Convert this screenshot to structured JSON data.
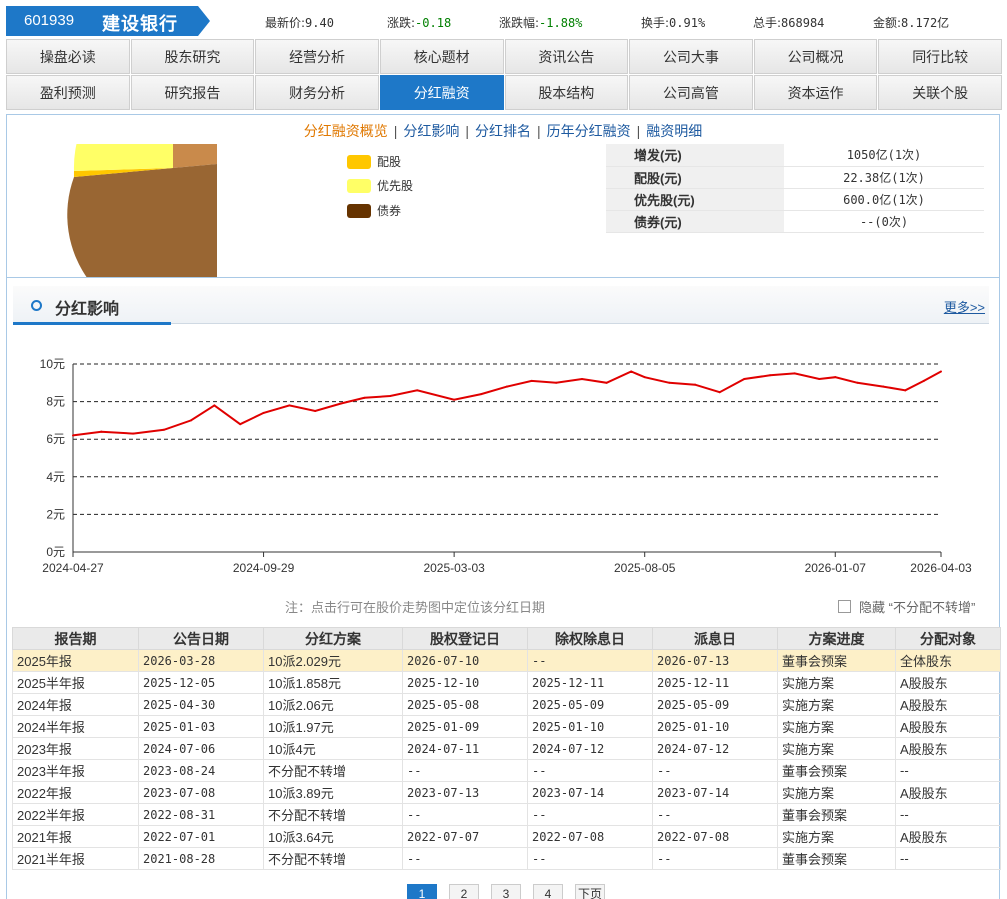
{
  "header": {
    "code": "601939",
    "name": "建设银行",
    "quotes": [
      {
        "label": "最新价:",
        "value": "9.40",
        "green": false
      },
      {
        "label": "涨跌:",
        "value": "-0.18",
        "green": true
      },
      {
        "label": "涨跌幅:",
        "value": "-1.88%",
        "green": true
      },
      {
        "label": "换手:",
        "value": "0.91%",
        "green": false
      },
      {
        "label": "总手:",
        "value": "868984",
        "green": false
      },
      {
        "label": "金额:",
        "value": "8.172亿",
        "green": false
      }
    ]
  },
  "nav": {
    "row1": [
      "操盘必读",
      "股东研究",
      "经营分析",
      "核心题材",
      "资讯公告",
      "公司大事",
      "公司概况",
      "同行比较"
    ],
    "row2": [
      "盈利预测",
      "研究报告",
      "财务分析",
      "分红融资",
      "股本结构",
      "公司高管",
      "资本运作",
      "关联个股"
    ],
    "active": "分红融资"
  },
  "subnav": {
    "items": [
      "分红融资概览",
      "分红影响",
      "分红排名",
      "历年分红融资",
      "融资明细"
    ],
    "active": "分红融资概览"
  },
  "pie": {
    "legend": [
      {
        "label": "配股",
        "color": "#ffc700"
      },
      {
        "label": "优先股",
        "color": "#ffff66"
      },
      {
        "label": "债券",
        "color": "#663300"
      }
    ],
    "finance": [
      {
        "k": "增发(元)",
        "v": "1050亿(1次)"
      },
      {
        "k": "配股(元)",
        "v": "22.38亿(1次)"
      },
      {
        "k": "优先股(元)",
        "v": "600.0亿(1次)"
      },
      {
        "k": "债券(元)",
        "v": "--(0次)"
      }
    ]
  },
  "section": {
    "title": "分红影响",
    "more": "更多>>"
  },
  "chart_data": {
    "type": "line",
    "x_ticks": [
      "2024-04-27",
      "2024-09-29",
      "2025-03-03",
      "2025-08-05",
      "2026-01-07",
      "2026-04-03"
    ],
    "y_ticks": [
      "0元",
      "2元",
      "4元",
      "6元",
      "8元",
      "10元"
    ],
    "ylim": [
      0,
      10
    ],
    "grid": true,
    "color": "#e00000",
    "x": [
      "2024-04-27",
      "2024-05-20",
      "2024-06-15",
      "2024-07-10",
      "2024-08-01",
      "2024-08-20",
      "2024-09-10",
      "2024-09-29",
      "2024-10-20",
      "2024-11-10",
      "2024-12-01",
      "2024-12-20",
      "2025-01-10",
      "2025-02-01",
      "2025-03-03",
      "2025-03-25",
      "2025-04-15",
      "2025-05-05",
      "2025-05-25",
      "2025-06-15",
      "2025-07-05",
      "2025-07-25",
      "2025-08-05",
      "2025-08-25",
      "2025-09-15",
      "2025-10-05",
      "2025-10-25",
      "2025-11-15",
      "2025-12-05",
      "2025-12-25",
      "2026-01-07",
      "2026-01-25",
      "2026-02-15",
      "2026-03-05",
      "2026-03-20",
      "2026-04-03"
    ],
    "values": [
      6.2,
      6.4,
      6.3,
      6.5,
      7.0,
      7.8,
      6.8,
      7.4,
      7.8,
      7.5,
      7.9,
      8.2,
      8.3,
      8.6,
      8.1,
      8.4,
      8.8,
      9.1,
      9.0,
      9.2,
      9.0,
      9.6,
      9.3,
      9.0,
      8.9,
      8.5,
      9.2,
      9.4,
      9.5,
      9.2,
      9.3,
      9.0,
      8.8,
      8.6,
      9.1,
      9.6
    ]
  },
  "note": "注：点击行可在股价走势图中定位该分红日期",
  "hide_option": "隐藏 “不分配不转增”",
  "table": {
    "headers": [
      "报告期",
      "公告日期",
      "分红方案",
      "股权登记日",
      "除权除息日",
      "派息日",
      "方案进度",
      "分配对象"
    ],
    "rows": [
      [
        "2025年报",
        "2026-03-28",
        "10派2.029元",
        "2026-07-10",
        "--",
        "2026-07-13",
        "董事会预案",
        "全体股东"
      ],
      [
        "2025半年报",
        "2025-12-05",
        "10派1.858元",
        "2025-12-10",
        "2025-12-11",
        "2025-12-11",
        "实施方案",
        "A股股东"
      ],
      [
        "2024年报",
        "2025-04-30",
        "10派2.06元",
        "2025-05-08",
        "2025-05-09",
        "2025-05-09",
        "实施方案",
        "A股股东"
      ],
      [
        "2024半年报",
        "2025-01-03",
        "10派1.97元",
        "2025-01-09",
        "2025-01-10",
        "2025-01-10",
        "实施方案",
        "A股股东"
      ],
      [
        "2023年报",
        "2024-07-06",
        "10派4元",
        "2024-07-11",
        "2024-07-12",
        "2024-07-12",
        "实施方案",
        "A股股东"
      ],
      [
        "2023半年报",
        "2023-08-24",
        "不分配不转增",
        "--",
        "--",
        "--",
        "董事会预案",
        "--"
      ],
      [
        "2022年报",
        "2023-07-08",
        "10派3.89元",
        "2023-07-13",
        "2023-07-14",
        "2023-07-14",
        "实施方案",
        "A股股东"
      ],
      [
        "2022半年报",
        "2022-08-31",
        "不分配不转增",
        "--",
        "--",
        "--",
        "董事会预案",
        "--"
      ],
      [
        "2021年报",
        "2022-07-01",
        "10派3.64元",
        "2022-07-07",
        "2022-07-08",
        "2022-07-08",
        "实施方案",
        "A股股东"
      ],
      [
        "2021半年报",
        "2021-08-28",
        "不分配不转增",
        "--",
        "--",
        "--",
        "董事会预案",
        "--"
      ]
    ],
    "highlight_row": 0
  },
  "pager": [
    "1",
    "2",
    "3",
    "4",
    "下页"
  ]
}
